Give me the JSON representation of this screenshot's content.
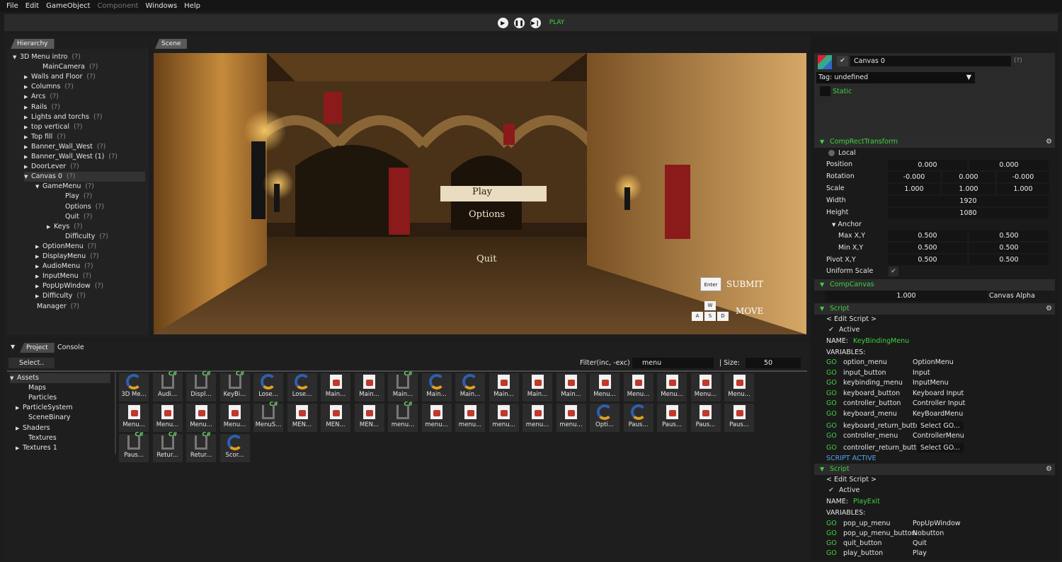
{
  "menu": [
    "File",
    "Edit",
    "GameObject",
    "Component",
    "Windows",
    "Help"
  ],
  "toolbar": {
    "status": "PLAY"
  },
  "hierarchy": {
    "tab": "Hierarchy",
    "rows": [
      {
        "label": "3D Menu intro",
        "indent": 0,
        "arrow": "▼",
        "q": "(?)"
      },
      {
        "label": "MainCamera",
        "indent": 2,
        "arrow": "",
        "q": "(?)"
      },
      {
        "label": "Walls and Floor",
        "indent": 1,
        "arrow": "▶",
        "q": "(?)"
      },
      {
        "label": "Columns",
        "indent": 1,
        "arrow": "▶",
        "q": "(?)"
      },
      {
        "label": "Arcs",
        "indent": 1,
        "arrow": "▶",
        "q": "(?)"
      },
      {
        "label": "Rails",
        "indent": 1,
        "arrow": "▶",
        "q": "(?)"
      },
      {
        "label": "Lights and torchs",
        "indent": 1,
        "arrow": "▶",
        "q": "(?)"
      },
      {
        "label": "top vertical",
        "indent": 1,
        "arrow": "▶",
        "q": "(?)"
      },
      {
        "label": "Top fill",
        "indent": 1,
        "arrow": "▶",
        "q": "(?)"
      },
      {
        "label": "Banner_Wall_West",
        "indent": 1,
        "arrow": "▶",
        "q": "(?)"
      },
      {
        "label": "Banner_Wall_West (1)",
        "indent": 1,
        "arrow": "▶",
        "q": "(?)"
      },
      {
        "label": "DoorLever",
        "indent": 1,
        "arrow": "▶",
        "q": "(?)"
      },
      {
        "label": "Canvas 0",
        "indent": 1,
        "arrow": "▼",
        "q": "(?)",
        "selected": true
      },
      {
        "label": "GameMenu",
        "indent": 2,
        "arrow": "▼",
        "q": "(?)"
      },
      {
        "label": "Play",
        "indent": 4,
        "arrow": "",
        "q": "(?)"
      },
      {
        "label": "Options",
        "indent": 4,
        "arrow": "",
        "q": "(?)"
      },
      {
        "label": "Quit",
        "indent": 4,
        "arrow": "",
        "q": "(?)"
      },
      {
        "label": "Keys",
        "indent": 3,
        "arrow": "▶",
        "q": "(?)"
      },
      {
        "label": "Difficulty",
        "indent": 4,
        "arrow": "",
        "q": "(?)"
      },
      {
        "label": "OptionMenu",
        "indent": 2,
        "arrow": "▶",
        "q": "(?)"
      },
      {
        "label": "DisplayMenu",
        "indent": 2,
        "arrow": "▶",
        "q": "(?)"
      },
      {
        "label": "AudioMenu",
        "indent": 2,
        "arrow": "▶",
        "q": "(?)"
      },
      {
        "label": "InputMenu",
        "indent": 2,
        "arrow": "▶",
        "q": "(?)"
      },
      {
        "label": "PopUpWindow",
        "indent": 2,
        "arrow": "▶",
        "q": "(?)"
      },
      {
        "label": "Difficulty",
        "indent": 2,
        "arrow": "▶",
        "q": "(?)"
      },
      {
        "label": "Manager",
        "indent": 1.5,
        "arrow": "",
        "q": "(?)"
      }
    ]
  },
  "scene": {
    "tab": "Scene",
    "menu_play": "Play",
    "menu_options": "Options",
    "menu_quit": "Quit",
    "enter_key": "Enter",
    "submit": "SUBMIT",
    "keys": [
      "W",
      "A",
      "S",
      "D"
    ],
    "move": "MOVE"
  },
  "project": {
    "tabs": [
      "Project",
      "Console"
    ],
    "select": "Select..",
    "filter_label": "Filter(inc, -exc)",
    "filter_value": "menu",
    "size_label": "Size:",
    "size_value": "50",
    "tree": [
      {
        "label": "Assets",
        "arrow": "▼",
        "indent": 0,
        "selected": true
      },
      {
        "label": "Maps",
        "arrow": "",
        "indent": 1
      },
      {
        "label": "Particles",
        "arrow": "",
        "indent": 1
      },
      {
        "label": "ParticleSystem",
        "arrow": "▶",
        "indent": 0.5
      },
      {
        "label": "SceneBinary",
        "arrow": "",
        "indent": 1
      },
      {
        "label": "Shaders",
        "arrow": "▶",
        "indent": 0.5
      },
      {
        "label": "Textures",
        "arrow": "",
        "indent": 1
      },
      {
        "label": "Textures 1",
        "arrow": "▶",
        "indent": 0.5
      }
    ],
    "assets": [
      {
        "label": "3D Me...",
        "icon": "c"
      },
      {
        "label": "Audi...",
        "icon": "cs"
      },
      {
        "label": "Displ...",
        "icon": "cs"
      },
      {
        "label": "KeyBi...",
        "icon": "cs"
      },
      {
        "label": "Lose...",
        "icon": "c"
      },
      {
        "label": "Lose...",
        "icon": "c"
      },
      {
        "label": "Main...",
        "icon": "doc"
      },
      {
        "label": "Main...",
        "icon": "doc"
      },
      {
        "label": "Main...",
        "icon": "cs"
      },
      {
        "label": "Main...",
        "icon": "c"
      },
      {
        "label": "Main...",
        "icon": "c"
      },
      {
        "label": "Main...",
        "icon": "doc"
      },
      {
        "label": "Main...",
        "icon": "doc"
      },
      {
        "label": "Main...",
        "icon": "doc"
      },
      {
        "label": "Menu...",
        "icon": "doc"
      },
      {
        "label": "Menu...",
        "icon": "doc"
      },
      {
        "label": "Menu...",
        "icon": "doc"
      },
      {
        "label": "Menu...",
        "icon": "doc"
      },
      {
        "label": "Menu...",
        "icon": "doc"
      },
      {
        "label": "Menu...",
        "icon": "doc"
      },
      {
        "label": "Menu...",
        "icon": "doc"
      },
      {
        "label": "Menu...",
        "icon": "doc"
      },
      {
        "label": "Menu...",
        "icon": "doc"
      },
      {
        "label": "MenuS...",
        "icon": "cs"
      },
      {
        "label": "MEN...",
        "icon": "doc"
      },
      {
        "label": "MEN...",
        "icon": "doc"
      },
      {
        "label": "MEN...",
        "icon": "doc"
      },
      {
        "label": "menu...",
        "icon": "cs"
      },
      {
        "label": "menu...",
        "icon": "doc"
      },
      {
        "label": "menu...",
        "icon": "doc"
      },
      {
        "label": "menu...",
        "icon": "doc"
      },
      {
        "label": "menu...",
        "icon": "doc"
      },
      {
        "label": "menu...",
        "icon": "doc"
      },
      {
        "label": "Opti...",
        "icon": "c"
      },
      {
        "label": "Paus...",
        "icon": "c"
      },
      {
        "label": "Paus...",
        "icon": "doc"
      },
      {
        "label": "Paus...",
        "icon": "doc"
      },
      {
        "label": "Paus...",
        "icon": "doc"
      },
      {
        "label": "Paus...",
        "icon": "cs"
      },
      {
        "label": "Retur...",
        "icon": "cs"
      },
      {
        "label": "Retur...",
        "icon": "cs"
      },
      {
        "label": "Scor...",
        "icon": "c"
      }
    ]
  },
  "inspector": {
    "name": "Canvas 0",
    "q": "(?)",
    "tag_label": "Tag:",
    "tag_value": "undefined",
    "static_label": "Static",
    "rect": {
      "title": "CompRectTransform",
      "local": "Local",
      "position_label": "Position",
      "position": [
        "0.000",
        "0.000"
      ],
      "rotation_label": "Rotation",
      "rotation": [
        "-0.000",
        "0.000",
        "-0.000"
      ],
      "scale_label": "Scale",
      "scale": [
        "1.000",
        "1.000",
        "1.000"
      ],
      "width_label": "Width",
      "width": "1920",
      "height_label": "Height",
      "height": "1080",
      "anchor_label": "Anchor",
      "max_label": "Max X,Y",
      "max": [
        "0.500",
        "0.500"
      ],
      "min_label": "Min X,Y",
      "min": [
        "0.500",
        "0.500"
      ],
      "pivot_label": "Pivot X,Y",
      "pivot": [
        "0.500",
        "0.500"
      ],
      "uniform_label": "Uniform Scale"
    },
    "canvas": {
      "title": "CompCanvas",
      "alpha": "1.000",
      "alpha_label": "Canvas Alpha"
    },
    "script1": {
      "title": "Script",
      "edit": "< Edit Script >",
      "active": "Active",
      "name_label": "NAME:",
      "name": "KeyBindingMenu",
      "vars_label": "VARIABLES:",
      "vars": [
        {
          "k": "GO",
          "n": "option_menu",
          "v": "OptionMenu",
          "btn": false
        },
        {
          "k": "GO",
          "n": "input_button",
          "v": "Input",
          "btn": false
        },
        {
          "k": "GO",
          "n": "keybinding_menu",
          "v": "InputMenu",
          "btn": false
        },
        {
          "k": "GO",
          "n": "keyboard_button",
          "v": "Keyboard Input",
          "btn": false
        },
        {
          "k": "GO",
          "n": "controller_button",
          "v": "Controller Input",
          "btn": false
        },
        {
          "k": "GO",
          "n": "keyboard_menu",
          "v": "KeyBoardMenu",
          "btn": false
        },
        {
          "k": "GO",
          "n": "keyboard_return_button",
          "v": "Select GO...",
          "btn": true
        },
        {
          "k": "GO",
          "n": "controller_menu",
          "v": "ControllerMenu",
          "btn": false
        },
        {
          "k": "GO",
          "n": "controller_return_button",
          "v": "Select GO...",
          "btn": true
        }
      ],
      "status": "SCRIPT ACTIVE"
    },
    "script2": {
      "title": "Script",
      "edit": "< Edit Script >",
      "active": "Active",
      "name_label": "NAME:",
      "name": "PlayExit",
      "vars_label": "VARIABLES:",
      "vars": [
        {
          "k": "GO",
          "n": "pop_up_menu",
          "v": "PopUpWindow"
        },
        {
          "k": "GO",
          "n": "pop_up_menu_button",
          "v": "Nobutton"
        },
        {
          "k": "GO",
          "n": "quit_button",
          "v": "Quit"
        },
        {
          "k": "GO",
          "n": "play_button",
          "v": "Play"
        }
      ]
    }
  }
}
